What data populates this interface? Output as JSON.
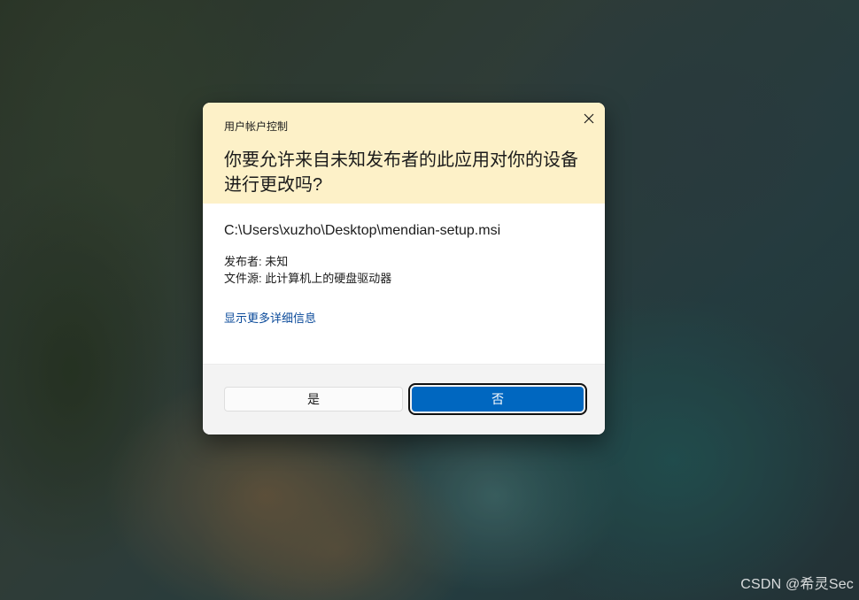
{
  "dialog": {
    "app_title": "用户帐户控制",
    "question": "你要允许来自未知发布者的此应用对你的设备进行更改吗?",
    "file_path": "C:\\Users\\xuzho\\Desktop\\mendian-setup.msi",
    "publisher": "发布者: 未知",
    "file_origin": "文件源: 此计算机上的硬盘驱动器",
    "details_link": "显示更多详细信息",
    "yes_label": "是",
    "no_label": "否",
    "close_icon": "close-icon"
  },
  "watermark": "CSDN @希灵Sec",
  "colors": {
    "header_bg": "#fdf1c8",
    "primary_button": "#0067c0",
    "link": "#0a4a9a"
  }
}
